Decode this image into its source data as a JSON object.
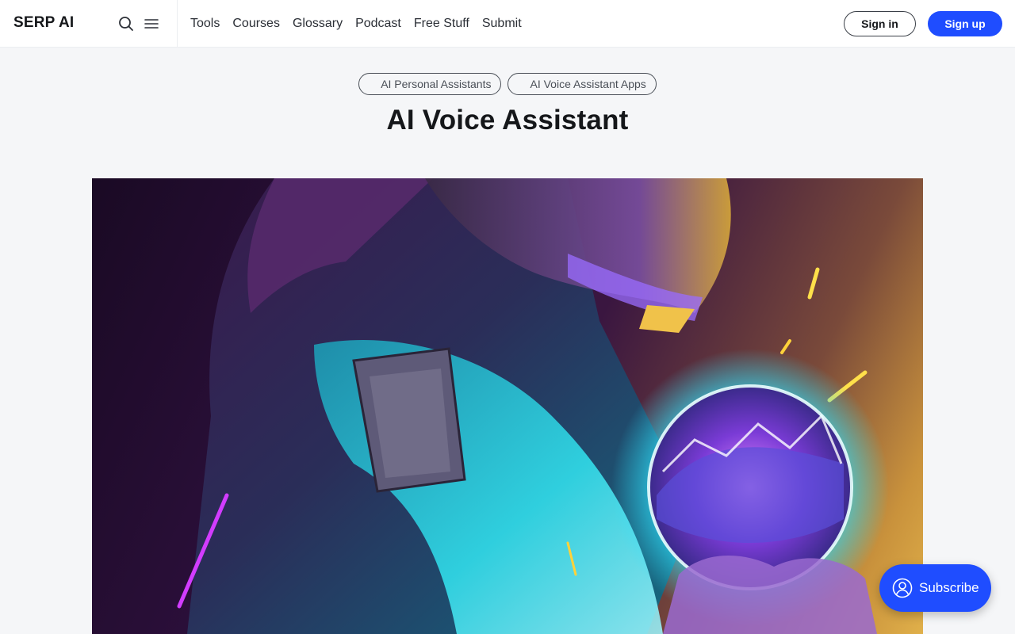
{
  "header": {
    "logo": "SERP AI",
    "nav": [
      "Tools",
      "Courses",
      "Glossary",
      "Podcast",
      "Free Stuff",
      "Submit"
    ],
    "sign_in": "Sign in",
    "sign_up": "Sign up"
  },
  "tags": [
    "AI Personal Assistants",
    "AI Voice Assistant Apps"
  ],
  "title": "AI Voice Assistant",
  "subscribe": "Subscribe",
  "colors": {
    "accent": "#1f4dff",
    "background": "#f5f6f8",
    "text": "#15171a"
  },
  "icons": {
    "search": "search-icon",
    "menu": "hamburger-menu-icon",
    "subscribe": "user-icon"
  }
}
